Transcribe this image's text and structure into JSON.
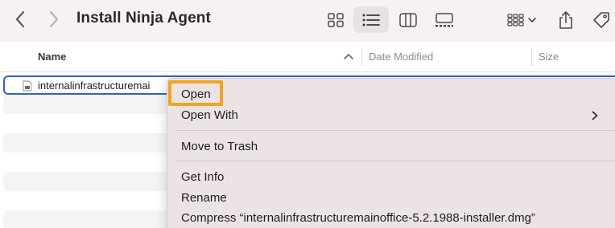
{
  "window": {
    "title": "Install Ninja Agent"
  },
  "toolbar": {
    "back_icon": "chevron-left-icon",
    "forward_icon": "chevron-right-icon",
    "view_modes": [
      "icons",
      "list",
      "columns",
      "gallery"
    ],
    "selected_view": "list",
    "group_icon": "group-grid-icon",
    "share_icon": "share-icon",
    "tags_icon": "tag-icon"
  },
  "columns": {
    "name": "Name",
    "date_modified": "Date Modified",
    "size": "Size",
    "sort": "ascending"
  },
  "files": [
    {
      "name": "internalinfrastructuremai",
      "selected": true
    }
  ],
  "context_menu": {
    "items": {
      "open": "Open",
      "open_with": "Open With",
      "move_to_trash": "Move to Trash",
      "get_info": "Get Info",
      "rename": "Rename",
      "compress": "Compress “internalinfrastructuremainoffice-5.2.1988-installer.dmg”"
    },
    "highlighted_item": "open"
  },
  "colors": {
    "toolbar_bg": "#f7f2f2",
    "selection_border": "#2e62d0",
    "menu_bg": "#ece4e4",
    "highlight_outline": "#f2a322"
  }
}
